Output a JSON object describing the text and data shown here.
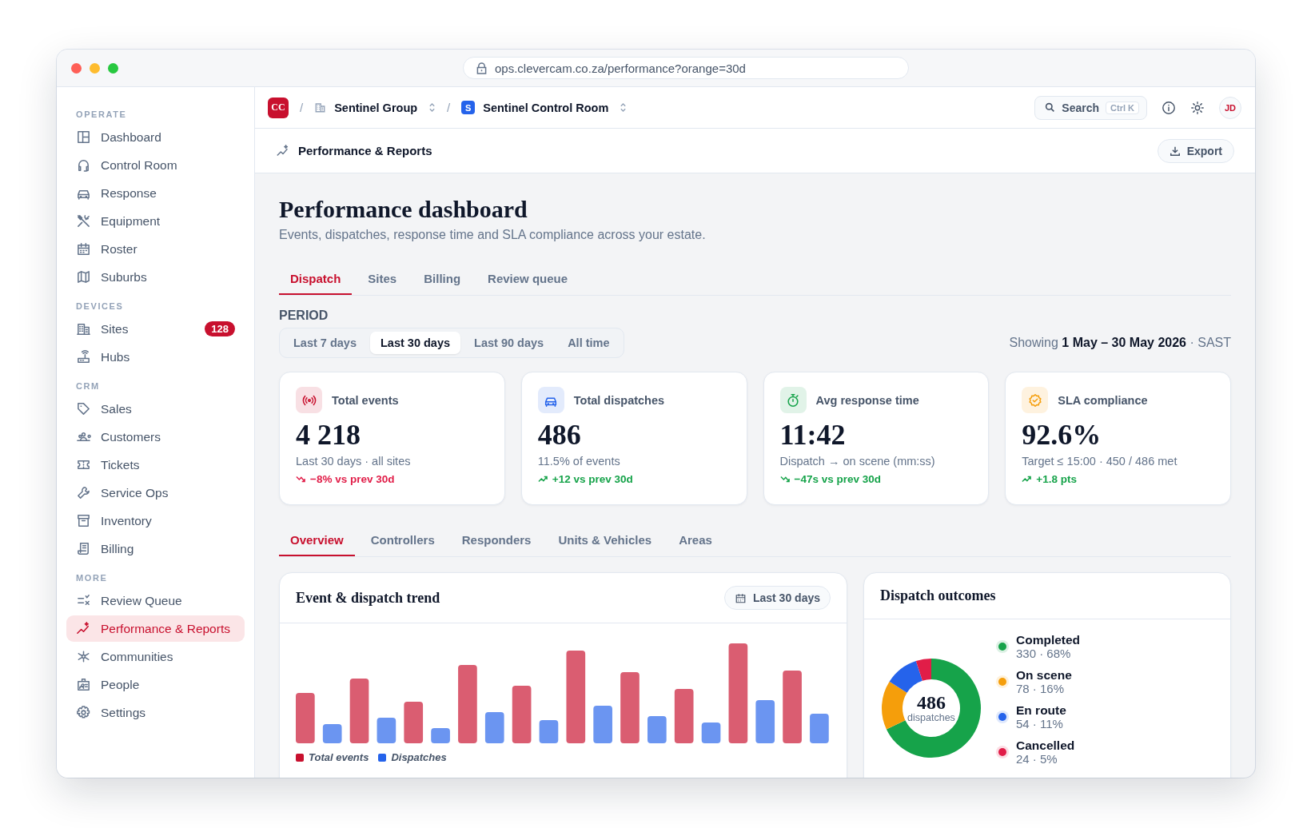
{
  "browser": {
    "url": "ops.clevercam.co.za/performance?orange=30d"
  },
  "sidebar": {
    "sections": [
      {
        "label": "OPERATE",
        "items": [
          {
            "label": "Dashboard",
            "selected": false
          },
          {
            "label": "Control Room",
            "selected": false
          },
          {
            "label": "Response",
            "selected": false
          },
          {
            "label": "Equipment",
            "selected": false
          },
          {
            "label": "Roster",
            "selected": false
          },
          {
            "label": "Suburbs",
            "selected": false
          }
        ]
      },
      {
        "label": "DEVICES",
        "items": [
          {
            "label": "Sites",
            "selected": false,
            "badge": "128"
          },
          {
            "label": "Hubs",
            "selected": false
          }
        ]
      },
      {
        "label": "CRM",
        "items": [
          {
            "label": "Sales",
            "selected": false
          },
          {
            "label": "Customers",
            "selected": false
          },
          {
            "label": "Tickets",
            "selected": false
          },
          {
            "label": "Service Ops",
            "selected": false
          },
          {
            "label": "Inventory",
            "selected": false
          },
          {
            "label": "Billing",
            "selected": false
          }
        ]
      },
      {
        "label": "MORE",
        "items": [
          {
            "label": "Review Queue",
            "selected": false
          },
          {
            "label": "Performance & Reports",
            "selected": true
          },
          {
            "label": "Communities",
            "selected": false
          },
          {
            "label": "People",
            "selected": false
          },
          {
            "label": "Settings",
            "selected": false
          }
        ]
      }
    ]
  },
  "header": {
    "logo": "CC",
    "separators": [
      "/",
      "/"
    ],
    "org": "Sentinel Group",
    "room_initial": "S",
    "room": "Sentinel Control Room",
    "search": {
      "label": "Search",
      "shortcut": "Ctrl K"
    },
    "avatar": "JD"
  },
  "page_header": {
    "title": "Performance & Reports",
    "export": "Export"
  },
  "title": "Performance dashboard",
  "subtitle": "Events, dispatches, response time and SLA compliance across your estate.",
  "tabs": [
    {
      "label": "Dispatch",
      "selected": true
    },
    {
      "label": "Sites",
      "selected": false
    },
    {
      "label": "Billing",
      "selected": false
    },
    {
      "label": "Review queue",
      "selected": false
    }
  ],
  "period": {
    "label": "PERIOD",
    "options": [
      {
        "label": "Last 7 days",
        "selected": false
      },
      {
        "label": "Last 30 days",
        "selected": true
      },
      {
        "label": "Last 90 days",
        "selected": false
      },
      {
        "label": "All time",
        "selected": false
      }
    ],
    "showing": "Showing **1 May – 30 May 2026** · SAST"
  },
  "kpis": [
    {
      "title": "Total events",
      "color": "#c8102e",
      "value": "4 218",
      "note": "Last 30 days · all sites",
      "delta": "−8% vs prev 30d",
      "rising": false,
      "favorable": false
    },
    {
      "title": "Total dispatches",
      "color": "#2563eb",
      "value": "486",
      "note": "11.5% of events",
      "delta": "+12 vs prev 30d",
      "rising": true,
      "favorable": true
    },
    {
      "title": "Avg response time",
      "color": "#16a34a",
      "value": "11:42",
      "note": "Dispatch → on scene (mm:ss)",
      "delta": "−47s vs prev 30d",
      "rising": false,
      "favorable": true
    },
    {
      "title": "SLA compliance",
      "color": "#f59e0b",
      "value": "92.6%",
      "note": "Target ≤ 15:00 · 450 / 486 met",
      "delta": "+1.8 pts",
      "rising": true,
      "favorable": true
    }
  ],
  "subtabs": [
    {
      "label": "Overview",
      "selected": true
    },
    {
      "label": "Controllers",
      "selected": false
    },
    {
      "label": "Responders",
      "selected": false
    },
    {
      "label": "Units & Vehicles",
      "selected": false
    },
    {
      "label": "Areas",
      "selected": false
    }
  ],
  "trend": {
    "title": "Event & dispatch trend",
    "range": "Last 30 days",
    "legend": [
      {
        "label": "Total events",
        "color": "#c8102e"
      },
      {
        "label": "Dispatches",
        "color": "#2563eb"
      }
    ]
  },
  "outcomes": {
    "title": "Dispatch outcomes",
    "center_value": "486",
    "center_label": "dispatches",
    "legend": [
      {
        "detail": "330 · 68%",
        "color": "#16a34a"
      },
      {
        "detail": "78 · 16%",
        "color": "#f59e0b"
      },
      {
        "detail": "54 · 11%",
        "color": "#2563eb"
      },
      {
        "detail": "24 · 5%",
        "color": "#e11d48"
      }
    ],
    "chart_data": {
      "type": "donut",
      "categories": [
        "Completed",
        "On scene",
        "En route",
        "Cancelled"
      ],
      "values": [
        68,
        16,
        11,
        5
      ]
    }
  }
}
